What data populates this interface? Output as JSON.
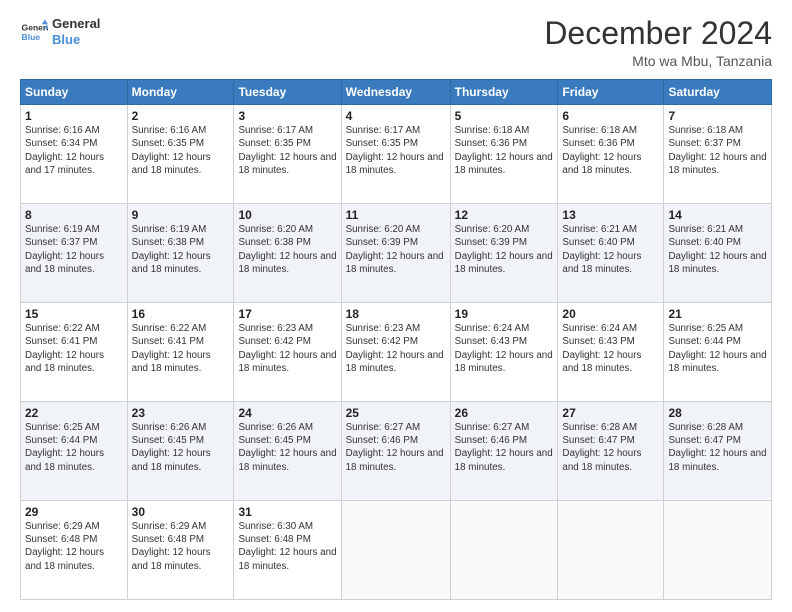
{
  "logo": {
    "text_general": "General",
    "text_blue": "Blue"
  },
  "header": {
    "month_title": "December 2024",
    "location": "Mto wa Mbu, Tanzania"
  },
  "days_of_week": [
    "Sunday",
    "Monday",
    "Tuesday",
    "Wednesday",
    "Thursday",
    "Friday",
    "Saturday"
  ],
  "weeks": [
    [
      {
        "num": "1",
        "sunrise": "6:16 AM",
        "sunset": "6:34 PM",
        "daylight": "12 hours and 17 minutes."
      },
      {
        "num": "2",
        "sunrise": "6:16 AM",
        "sunset": "6:35 PM",
        "daylight": "12 hours and 18 minutes."
      },
      {
        "num": "3",
        "sunrise": "6:17 AM",
        "sunset": "6:35 PM",
        "daylight": "12 hours and 18 minutes."
      },
      {
        "num": "4",
        "sunrise": "6:17 AM",
        "sunset": "6:35 PM",
        "daylight": "12 hours and 18 minutes."
      },
      {
        "num": "5",
        "sunrise": "6:18 AM",
        "sunset": "6:36 PM",
        "daylight": "12 hours and 18 minutes."
      },
      {
        "num": "6",
        "sunrise": "6:18 AM",
        "sunset": "6:36 PM",
        "daylight": "12 hours and 18 minutes."
      },
      {
        "num": "7",
        "sunrise": "6:18 AM",
        "sunset": "6:37 PM",
        "daylight": "12 hours and 18 minutes."
      }
    ],
    [
      {
        "num": "8",
        "sunrise": "6:19 AM",
        "sunset": "6:37 PM",
        "daylight": "12 hours and 18 minutes."
      },
      {
        "num": "9",
        "sunrise": "6:19 AM",
        "sunset": "6:38 PM",
        "daylight": "12 hours and 18 minutes."
      },
      {
        "num": "10",
        "sunrise": "6:20 AM",
        "sunset": "6:38 PM",
        "daylight": "12 hours and 18 minutes."
      },
      {
        "num": "11",
        "sunrise": "6:20 AM",
        "sunset": "6:39 PM",
        "daylight": "12 hours and 18 minutes."
      },
      {
        "num": "12",
        "sunrise": "6:20 AM",
        "sunset": "6:39 PM",
        "daylight": "12 hours and 18 minutes."
      },
      {
        "num": "13",
        "sunrise": "6:21 AM",
        "sunset": "6:40 PM",
        "daylight": "12 hours and 18 minutes."
      },
      {
        "num": "14",
        "sunrise": "6:21 AM",
        "sunset": "6:40 PM",
        "daylight": "12 hours and 18 minutes."
      }
    ],
    [
      {
        "num": "15",
        "sunrise": "6:22 AM",
        "sunset": "6:41 PM",
        "daylight": "12 hours and 18 minutes."
      },
      {
        "num": "16",
        "sunrise": "6:22 AM",
        "sunset": "6:41 PM",
        "daylight": "12 hours and 18 minutes."
      },
      {
        "num": "17",
        "sunrise": "6:23 AM",
        "sunset": "6:42 PM",
        "daylight": "12 hours and 18 minutes."
      },
      {
        "num": "18",
        "sunrise": "6:23 AM",
        "sunset": "6:42 PM",
        "daylight": "12 hours and 18 minutes."
      },
      {
        "num": "19",
        "sunrise": "6:24 AM",
        "sunset": "6:43 PM",
        "daylight": "12 hours and 18 minutes."
      },
      {
        "num": "20",
        "sunrise": "6:24 AM",
        "sunset": "6:43 PM",
        "daylight": "12 hours and 18 minutes."
      },
      {
        "num": "21",
        "sunrise": "6:25 AM",
        "sunset": "6:44 PM",
        "daylight": "12 hours and 18 minutes."
      }
    ],
    [
      {
        "num": "22",
        "sunrise": "6:25 AM",
        "sunset": "6:44 PM",
        "daylight": "12 hours and 18 minutes."
      },
      {
        "num": "23",
        "sunrise": "6:26 AM",
        "sunset": "6:45 PM",
        "daylight": "12 hours and 18 minutes."
      },
      {
        "num": "24",
        "sunrise": "6:26 AM",
        "sunset": "6:45 PM",
        "daylight": "12 hours and 18 minutes."
      },
      {
        "num": "25",
        "sunrise": "6:27 AM",
        "sunset": "6:46 PM",
        "daylight": "12 hours and 18 minutes."
      },
      {
        "num": "26",
        "sunrise": "6:27 AM",
        "sunset": "6:46 PM",
        "daylight": "12 hours and 18 minutes."
      },
      {
        "num": "27",
        "sunrise": "6:28 AM",
        "sunset": "6:47 PM",
        "daylight": "12 hours and 18 minutes."
      },
      {
        "num": "28",
        "sunrise": "6:28 AM",
        "sunset": "6:47 PM",
        "daylight": "12 hours and 18 minutes."
      }
    ],
    [
      {
        "num": "29",
        "sunrise": "6:29 AM",
        "sunset": "6:48 PM",
        "daylight": "12 hours and 18 minutes."
      },
      {
        "num": "30",
        "sunrise": "6:29 AM",
        "sunset": "6:48 PM",
        "daylight": "12 hours and 18 minutes."
      },
      {
        "num": "31",
        "sunrise": "6:30 AM",
        "sunset": "6:48 PM",
        "daylight": "12 hours and 18 minutes."
      },
      null,
      null,
      null,
      null
    ]
  ]
}
